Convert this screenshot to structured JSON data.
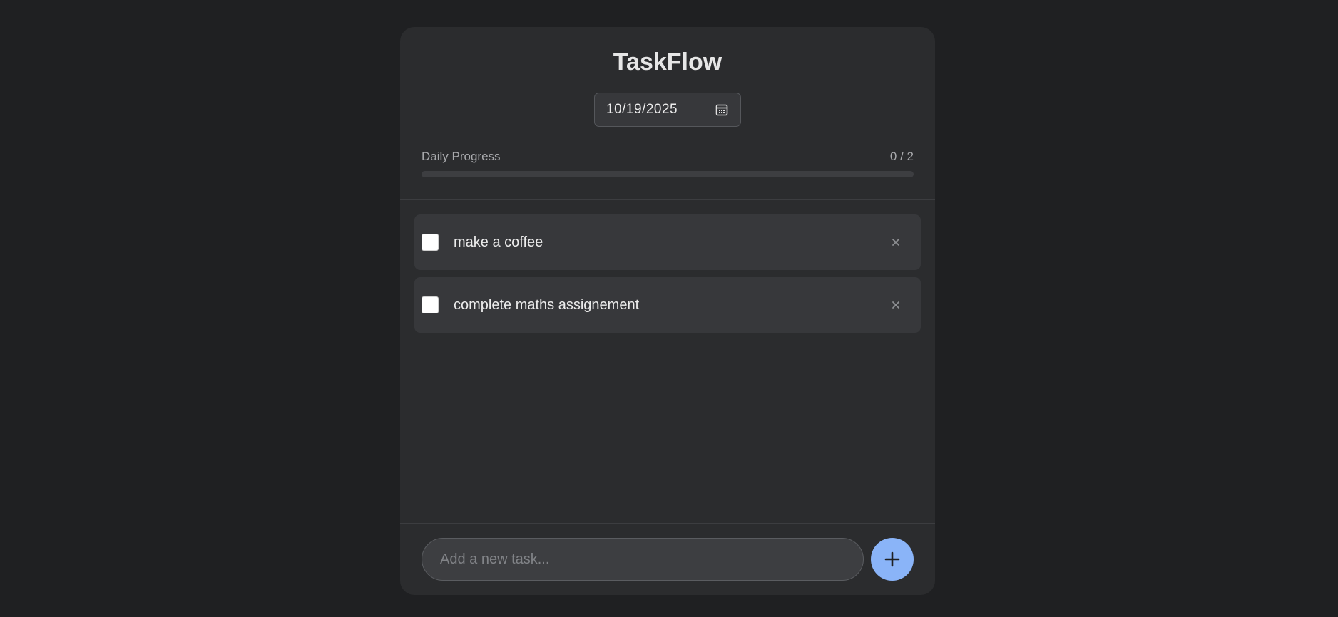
{
  "app": {
    "title": "TaskFlow"
  },
  "date_picker": {
    "value": "10/19/2025",
    "icon": "calendar-icon"
  },
  "progress": {
    "label": "Daily Progress",
    "count_text": "0 / 2",
    "completed": 0,
    "total": 2,
    "fill_fraction": 0
  },
  "tasks": [
    {
      "text": "make a coffee",
      "done": false
    },
    {
      "text": "complete maths assignement",
      "done": false
    }
  ],
  "task_delete_icon": "close-icon",
  "new_task": {
    "placeholder": "Add a new task...",
    "value": ""
  },
  "add_button": {
    "icon": "plus-icon"
  },
  "colors": {
    "background": "#1f2022",
    "panel": "#2b2c2e",
    "task_card": "#37383b",
    "accent": "#8ab4f8",
    "muted_text": "#a9aaad"
  }
}
